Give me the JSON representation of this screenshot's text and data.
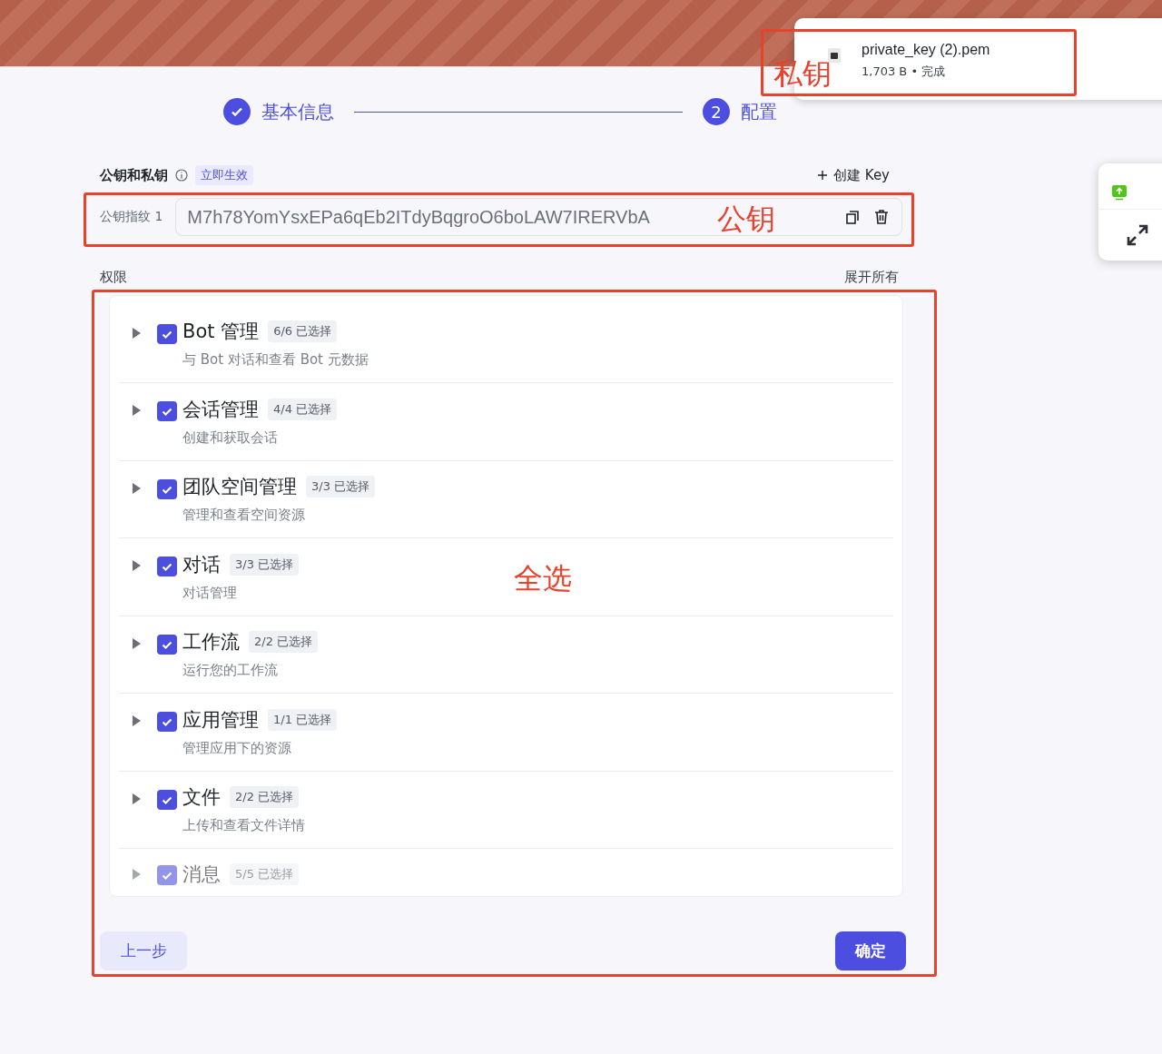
{
  "download_popup": {
    "filename": "private_key (2).pem",
    "status": "1,703 B • 完成"
  },
  "steps": [
    {
      "label": "基本信息",
      "done": true
    },
    {
      "number": "2",
      "label": "配置",
      "done": false
    }
  ],
  "keys_section": {
    "title": "公钥和私钥",
    "badge": "立即生效",
    "create_button": "创建 Key",
    "key_label": "公钥指纹 1",
    "key_value": "M7h78YomYsxEPa6qEb2ITdyBqgroO6boLAW7IRERVbA"
  },
  "permissions": {
    "title": "权限",
    "expand_all": "展开所有",
    "items": [
      {
        "name": "Bot 管理",
        "count": "6/6 已选择",
        "description": "与 Bot 对话和查看 Bot 元数据",
        "checked": true,
        "faded": false
      },
      {
        "name": "会话管理",
        "count": "4/4 已选择",
        "description": "创建和获取会话",
        "checked": true,
        "faded": false
      },
      {
        "name": "团队空间管理",
        "count": "3/3 已选择",
        "description": "管理和查看空间资源",
        "checked": true,
        "faded": false
      },
      {
        "name": "对话",
        "count": "3/3 已选择",
        "description": "对话管理",
        "checked": true,
        "faded": false
      },
      {
        "name": "工作流",
        "count": "2/2 已选择",
        "description": "运行您的工作流",
        "checked": true,
        "faded": false
      },
      {
        "name": "应用管理",
        "count": "1/1 已选择",
        "description": "管理应用下的资源",
        "checked": true,
        "faded": false
      },
      {
        "name": "文件",
        "count": "2/2 已选择",
        "description": "上传和查看文件详情",
        "checked": true,
        "faded": false
      },
      {
        "name": "消息",
        "count": "5/5 已选择",
        "checked": true,
        "faded": true
      }
    ]
  },
  "footer": {
    "back_button": "上一步",
    "confirm_button": "确定"
  },
  "annotations": [
    {
      "label": "私钥"
    },
    {
      "label": "公钥"
    },
    {
      "label": "全选"
    }
  ]
}
